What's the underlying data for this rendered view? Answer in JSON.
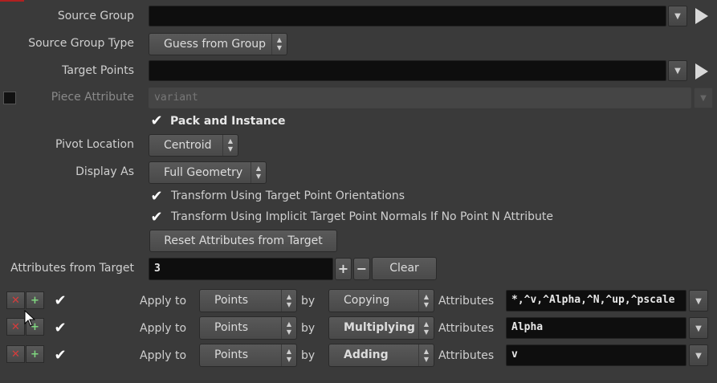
{
  "fields": {
    "source_group": {
      "label": "Source Group",
      "value": ""
    },
    "source_group_type": {
      "label": "Source Group Type",
      "value": "Guess from Group"
    },
    "target_points": {
      "label": "Target Points",
      "value": ""
    },
    "piece_attribute": {
      "label": "Piece Attribute",
      "placeholder": "variant"
    },
    "pack_and_instance": {
      "label": "Pack and Instance",
      "checked": true
    },
    "pivot_location": {
      "label": "Pivot Location",
      "value": "Centroid"
    },
    "display_as": {
      "label": "Display As",
      "value": "Full Geometry"
    },
    "transform_orientations": {
      "label": "Transform Using Target Point Orientations",
      "checked": true
    },
    "transform_normals": {
      "label": "Transform Using Implicit Target Point Normals If No Point N Attribute",
      "checked": true
    },
    "reset_button": {
      "label": "Reset Attributes from Target"
    },
    "attributes_from_target": {
      "label": "Attributes from Target",
      "value": "3",
      "plus": "+",
      "minus": "−",
      "clear": "Clear"
    }
  },
  "attribute_rows": [
    {
      "apply_label": "Apply to",
      "apply_value": "Points",
      "by_label": "by",
      "method": "Copying",
      "attr_label": "Attributes",
      "attributes": "*,^v,^Alpha,^N,^up,^pscale"
    },
    {
      "apply_label": "Apply to",
      "apply_value": "Points",
      "by_label": "by",
      "method": "Multiplying",
      "attr_label": "Attributes",
      "attributes": "Alpha"
    },
    {
      "apply_label": "Apply to",
      "apply_value": "Points",
      "by_label": "by",
      "method": "Adding",
      "attr_label": "Attributes",
      "attributes": "v"
    }
  ],
  "glyphs": {
    "check": "✔",
    "dropdown": "▼",
    "arrows_up": "▲",
    "arrows_down": "▼",
    "remove": "✕",
    "insert": "+"
  },
  "colors": {
    "background": "#3a3a3a",
    "field": "#0e0e0e",
    "button": "#505050"
  }
}
